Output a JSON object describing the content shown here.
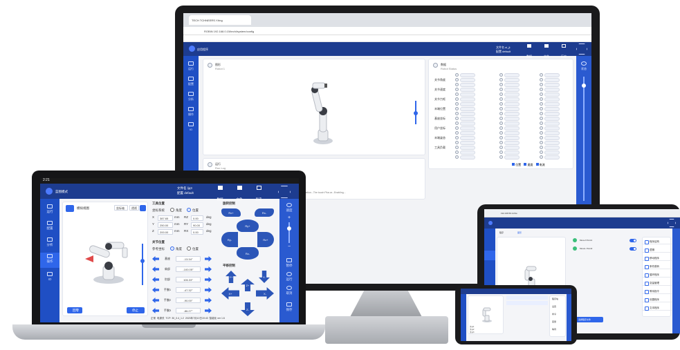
{
  "monitor": {
    "tab_title": "TECH TCHNEERS.Y.ting",
    "url": "ROBIN  192.168.0.15/techi/system/config",
    "app_title": "应用程序",
    "header_info_line1": "文件名 ui_jt",
    "header_info_line2": "配置 default",
    "header_buttons": [
      "数据",
      "文件",
      "历史"
    ],
    "sidebar": [
      "运行",
      "配置",
      "分析",
      "操作",
      "IO"
    ],
    "panel_left_title": "图形",
    "panel_left_sub": "Robot 1",
    "panel_right_title": "数据",
    "panel_right_sub": "Robot Status",
    "bottom_panel_title": "运行",
    "bottom_panel_sub": "Run Log",
    "log_rows": [
      {
        "id": "0 · Ollie · 0s",
        "time": "2023-07-20 15:16:09",
        "text": "已连接到机器人，请确认所有参数"
      },
      {
        "id": "0 · 09:08",
        "time": "2023-07-20 15:16:10",
        "text": "正在读取运行时配置，启动数据采集流程"
      }
    ],
    "footer_note": "1. Adjust the camera position...The touch Plus ar...Enabling...",
    "data_labels": [
      "关节角度",
      "关节速度",
      "关节力矩",
      "末端位置",
      "基座坐标",
      "用户坐标",
      "末端姿态",
      "工具负载"
    ],
    "legend": [
      "位置",
      "速度",
      "电流"
    ],
    "right_bar": [
      "状态",
      "运行",
      "暂停"
    ],
    "footer_label": "设置"
  },
  "laptop": {
    "status_time": "2:21",
    "app_title": "蓝图模式",
    "header_info_line1": "文件名 ljq3",
    "header_info_line2": "配置 default",
    "header_buttons": [
      "数据",
      "文件",
      "历史"
    ],
    "sidebar": [
      "运行",
      "配置",
      "分析",
      "操作",
      "IO"
    ],
    "scene_label": "模拟视图",
    "view_buttons": [
      "坐标轴",
      "透视"
    ],
    "bottom_buttons": [
      "回零",
      "停止"
    ],
    "tool_pos_title": "工具位置",
    "coord_label": "坐标系统",
    "coord_options": [
      "角度",
      "位置"
    ],
    "tool_fields": [
      {
        "axis": "X",
        "value": "387.65",
        "unit": "mm",
        "axis2": "RZ",
        "value2": "0.00",
        "unit2": "deg"
      },
      {
        "axis": "Y",
        "value": "250.00",
        "unit": "mm",
        "axis2": "RY",
        "value2": "90.00",
        "unit2": "deg"
      },
      {
        "axis": "Z",
        "value": "200.00",
        "unit": "mm",
        "axis2": "RX",
        "value2": "0.00",
        "unit2": "deg"
      }
    ],
    "joint_title": "关节位置",
    "joint_coord_label": "参考坐标",
    "joint_options": [
      "角度",
      "位置"
    ],
    "joints": [
      {
        "name": "基座",
        "value": "-13.34°"
      },
      {
        "name": "肩部",
        "value": "-100.05°"
      },
      {
        "name": "肘部",
        "value": "106.33°"
      },
      {
        "name": "手腕1",
        "value": "-47.32°"
      },
      {
        "name": "手腕2",
        "value": "-90.00°"
      },
      {
        "name": "手腕3",
        "value": "-86.27°"
      }
    ],
    "pad_title1": "旋转控制",
    "pad_title2": "平移控制",
    "pad_labels": [
      "Rx+",
      "Rx-",
      "Ry+",
      "Ry-",
      "Rz+",
      "Rz-"
    ],
    "translate_labels": [
      "Y+",
      "Y-",
      "X+",
      "X-",
      "Z+",
      "Z-"
    ],
    "right_bar": [
      "速度",
      "+",
      "−",
      "暂停",
      "运行",
      "取消",
      "保存"
    ],
    "footer_items": [
      "正常",
      "电源关",
      "TCP: 30_0.4_1.2",
      "2023年7月10日19:43",
      "智能化 ver 1.6"
    ]
  },
  "tablet": {
    "url": "192.168.56.11/hw",
    "tabs": [
      "程序",
      "图形"
    ],
    "program_rows": [
      "MoveJ Point1",
      "MoveL Point2"
    ],
    "right_menu": [
      "程序结构",
      "逻辑",
      "移动程序",
      "条件跳转",
      "循环程序",
      "变量管理",
      "等待指令",
      "设置程序",
      "文本程序"
    ],
    "footer_button": "选择程序文件"
  },
  "phone": {
    "rows": [
      "程序块",
      "设置",
      "命令",
      "变量",
      "等待"
    ],
    "labels": [
      "关节1",
      "关节2",
      "关节3"
    ]
  },
  "colors": {
    "brand_dark": "#1d3c8f",
    "brand": "#2f66ea",
    "sidebar": "#1f4fc4",
    "pad": "#2c56b8"
  }
}
